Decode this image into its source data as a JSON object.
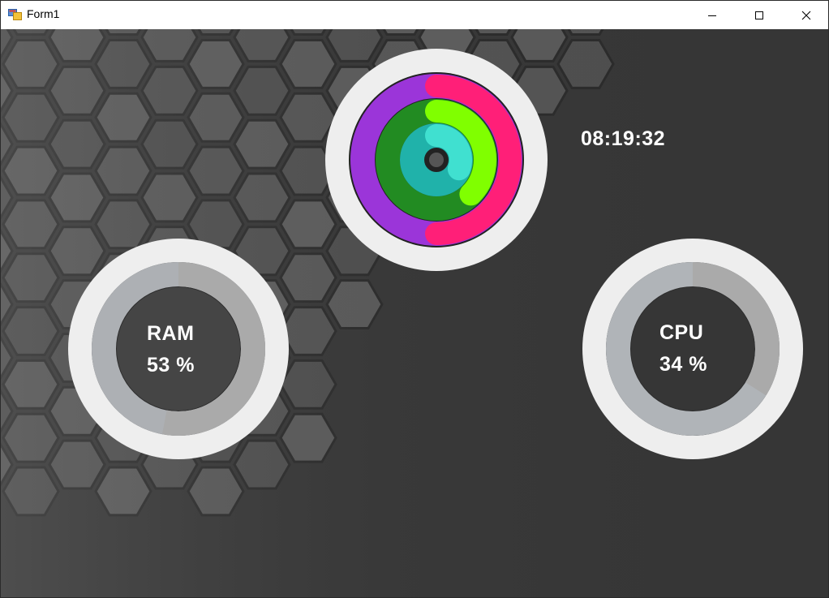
{
  "window": {
    "title": "Form1",
    "icon": "winforms-app-icon",
    "controls": [
      "minimize-icon",
      "maximize-icon",
      "close-icon"
    ]
  },
  "clock": {
    "time": "08:19:32"
  },
  "gauges": {
    "ram": {
      "label": "RAM",
      "value_text": "53 %",
      "percent": 53
    },
    "cpu": {
      "label": "CPU",
      "value_text": "34 %",
      "percent": 34
    }
  },
  "activity_rings": {
    "outer": {
      "color": "#ff1f78",
      "track_color": "#9b35d9"
    },
    "middle": {
      "color": "#80ff00",
      "track_color": "#228b22"
    },
    "inner": {
      "color": "#40e0d0",
      "track_color": "#20b2aa"
    }
  },
  "colors": {
    "background": "#363636",
    "hexagon": "#545454",
    "bezel": "#eeeeee",
    "gauge_fill": "#aaaaaa",
    "gauge_track": "#b0b4b8"
  }
}
